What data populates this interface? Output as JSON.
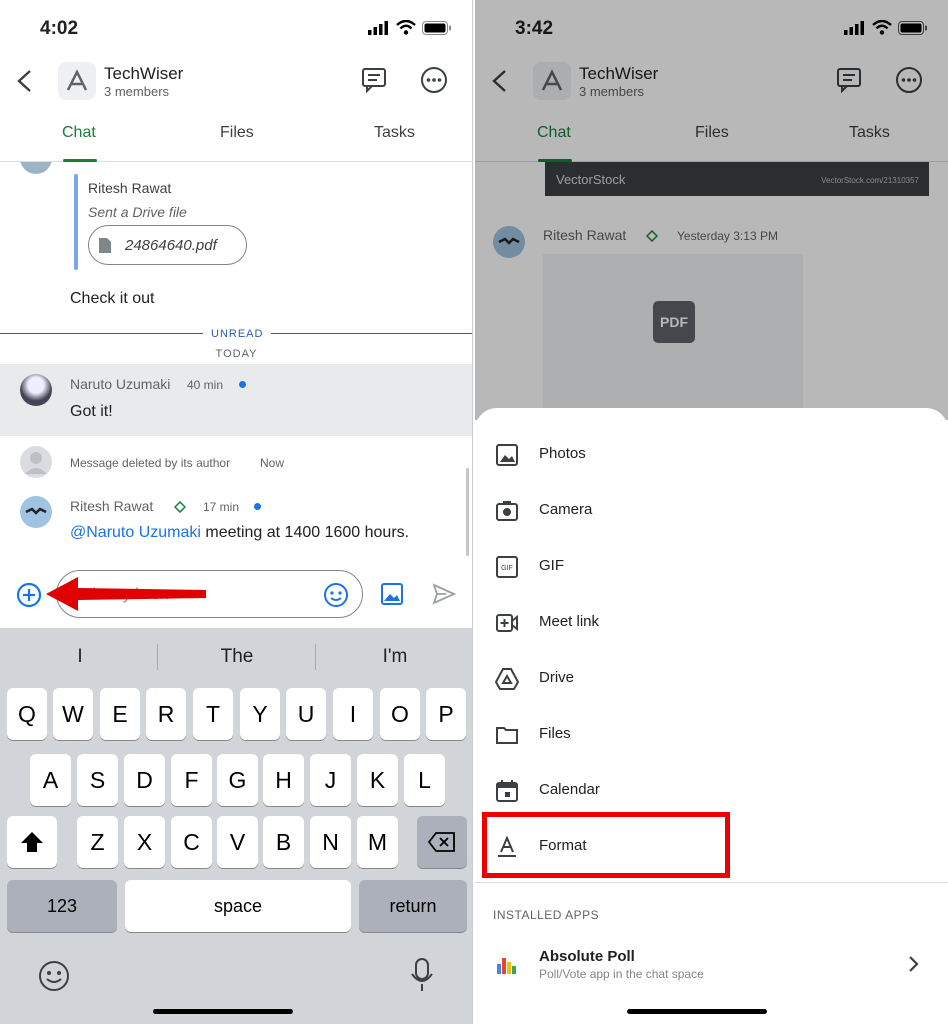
{
  "left": {
    "status_time": "4:02",
    "header": {
      "name": "TechWiser",
      "members": "3 members"
    },
    "tabs": [
      "Chat",
      "Files",
      "Tasks"
    ],
    "quoted": {
      "author": "Ritesh Rawat",
      "note": "Sent a Drive file",
      "file": "24864640.pdf"
    },
    "message_text": "Check it out",
    "unread_label": "UNREAD",
    "today_label": "TODAY",
    "msg1": {
      "author": "Naruto Uzumaki",
      "time": "40 min",
      "text": "Got it!"
    },
    "deleted": {
      "text": "Message deleted by its author",
      "time": "Now"
    },
    "msg2": {
      "author": "Ritesh Rawat",
      "time": "17 min",
      "mention": "@Naruto Uzumaki",
      "text": " meeting at 1400 1600 hours."
    },
    "composer_placeholder": "History is on",
    "suggestions": [
      "I",
      "The",
      "I'm"
    ],
    "rows": [
      [
        "Q",
        "W",
        "E",
        "R",
        "T",
        "Y",
        "U",
        "I",
        "O",
        "P"
      ],
      [
        "A",
        "S",
        "D",
        "F",
        "G",
        "H",
        "J",
        "K",
        "L"
      ],
      [
        "Z",
        "X",
        "C",
        "V",
        "B",
        "N",
        "M"
      ]
    ],
    "key_123": "123",
    "key_space": "space",
    "key_return": "return"
  },
  "right": {
    "status_time": "3:42",
    "header": {
      "name": "TechWiser",
      "members": "3 members"
    },
    "tabs": [
      "Chat",
      "Files",
      "Tasks"
    ],
    "banner": {
      "brand": "VectorStock",
      "url": "VectorStock.com/21310357"
    },
    "msg": {
      "author": "Ritesh Rawat",
      "time": "Yesterday 3:13 PM"
    },
    "pdf_label": "PDF",
    "menu": [
      "Photos",
      "Camera",
      "GIF",
      "Meet link",
      "Drive",
      "Files",
      "Calendar",
      "Format"
    ],
    "installed_header": "INSTALLED APPS",
    "app": {
      "name": "Absolute Poll",
      "desc": "Poll/Vote app in the chat space"
    }
  },
  "colors": {
    "accent_green": "#188038",
    "link_blue": "#1a73e8",
    "annotation_red": "#e00000"
  }
}
